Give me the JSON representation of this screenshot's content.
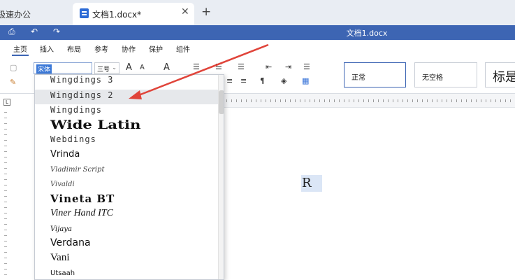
{
  "tabbar": {
    "inactive_tab": "极速办公",
    "active_tab": "文档1.docx*",
    "close_glyph": "✕",
    "add_glyph": "+"
  },
  "titlebar": {
    "title": "文档1.docx",
    "print_glyph": "⎙",
    "undo_glyph": "↶",
    "redo_glyph": "↷"
  },
  "menubar": {
    "items": [
      "主页",
      "插入",
      "布局",
      "参考",
      "协作",
      "保护",
      "组件"
    ]
  },
  "ribbon": {
    "font_name": "宋体",
    "font_size": "三号",
    "grow_font": "A",
    "shrink_font": "A",
    "clear_format": "A",
    "styles": [
      "正常",
      "无空格",
      "标是"
    ]
  },
  "ruler": {
    "corner": "L"
  },
  "document": {
    "char": "R"
  },
  "font_list": {
    "items": [
      {
        "label": "Wingdings 3",
        "selected": false
      },
      {
        "label": "Wingdings 2",
        "selected": true
      },
      {
        "label": "Wingdings",
        "selected": false
      },
      {
        "label": "Wide Latin",
        "selected": false
      },
      {
        "label": "Webdings",
        "selected": false
      },
      {
        "label": "Vrinda",
        "selected": false
      },
      {
        "label": "Vladimir Script",
        "selected": false
      },
      {
        "label": "Vivaldi",
        "selected": false
      },
      {
        "label": "Vineta BT",
        "selected": false
      },
      {
        "label": "Viner Hand ITC",
        "selected": false
      },
      {
        "label": "Vijaya",
        "selected": false
      },
      {
        "label": "Verdana",
        "selected": false
      },
      {
        "label": "Vani",
        "selected": false
      },
      {
        "label": "Utsaah",
        "selected": false
      }
    ]
  },
  "colors": {
    "accent": "#3d65b3",
    "annotation_arrow": "#e0443a",
    "selection": "#3d7ad8"
  }
}
